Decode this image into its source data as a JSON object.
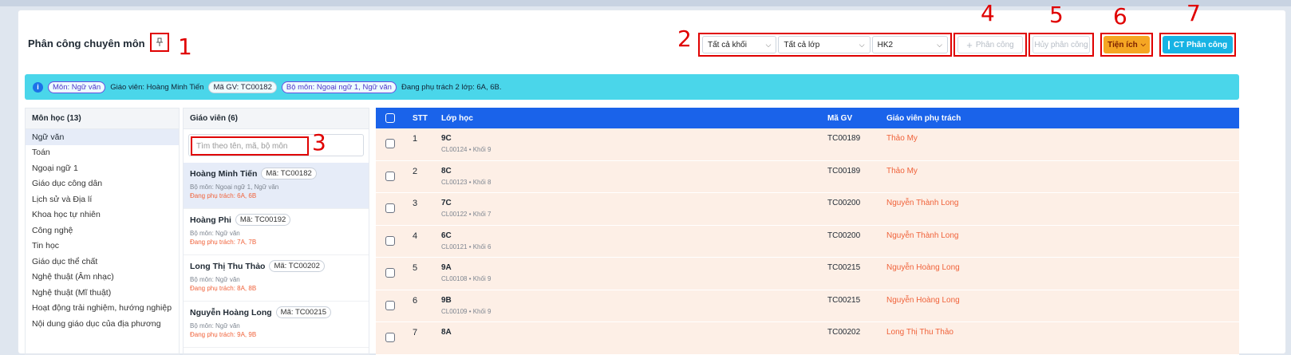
{
  "header": {
    "title": "Phân công chuyên môn",
    "pin_icon": "pin-icon",
    "filters": {
      "grade": "Tất cả khối",
      "class": "Tất cả lớp",
      "semester": "HK2"
    },
    "buttons": {
      "assign": "Phân công",
      "unassign": "Hủy phân công",
      "utilities": "Tiện ích",
      "detail": "CT Phân công"
    }
  },
  "annotations": [
    "1",
    "2",
    "3",
    "4",
    "5",
    "6",
    "7"
  ],
  "info": {
    "subject_tag": "Môn: Ngữ văn",
    "teacher": "Giáo viên: Hoàng Minh Tiến",
    "code": "Mã GV: TC00182",
    "dept_tag": "Bộ môn: Ngoại ngữ 1, Ngữ văn",
    "summary": "Đang phụ trách 2 lớp: 6A, 6B."
  },
  "subjects": {
    "header": "Môn học (13)",
    "items": [
      "Ngữ văn",
      "Toán",
      "Ngoại ngữ 1",
      "Giáo dục công dân",
      "Lịch sử và Địa lí",
      "Khoa học tự nhiên",
      "Công nghệ",
      "Tin học",
      "Giáo dục thể chất",
      "Nghệ thuật (Âm nhạc)",
      "Nghệ thuật (Mĩ thuật)",
      "Hoạt động trải nghiệm, hướng nghiệp",
      "Nội dung giáo dục của địa phương"
    ]
  },
  "teachers": {
    "header": "Giáo viên (6)",
    "search_placeholder": "Tìm theo tên, mã, bộ môn",
    "items": [
      {
        "name": "Hoàng Minh Tiến",
        "code": "Mã: TC00182",
        "dept": "Bộ môn: Ngoại ngữ 1, Ngữ văn",
        "resp": "Đang phụ trách: 6A, 6B"
      },
      {
        "name": "Hoàng Phi",
        "code": "Mã: TC00192",
        "dept": "Bộ môn: Ngữ văn",
        "resp": "Đang phụ trách: 7A, 7B"
      },
      {
        "name": "Long Thị Thu Thảo",
        "code": "Mã: TC00202",
        "dept": "Bộ môn: Ngữ văn",
        "resp": "Đang phụ trách: 8A, 8B"
      },
      {
        "name": "Nguyễn Hoàng Long",
        "code": "Mã: TC00215",
        "dept": "Bộ môn: Ngữ văn",
        "resp": "Đang phụ trách: 9A, 9B"
      }
    ]
  },
  "table": {
    "headers": {
      "stt": "STT",
      "class": "Lớp học",
      "code": "Mã GV",
      "resp": "Giáo viên phụ trách"
    },
    "rows": [
      {
        "stt": "1",
        "class": "9C",
        "sub": "CL00124 • Khối 9",
        "code": "TC00189",
        "resp": "Thảo My"
      },
      {
        "stt": "2",
        "class": "8C",
        "sub": "CL00123 • Khối 8",
        "code": "TC00189",
        "resp": "Thảo My"
      },
      {
        "stt": "3",
        "class": "7C",
        "sub": "CL00122 • Khối 7",
        "code": "TC00200",
        "resp": "Nguyễn Thành Long"
      },
      {
        "stt": "4",
        "class": "6C",
        "sub": "CL00121 • Khối 6",
        "code": "TC00200",
        "resp": "Nguyễn Thành Long"
      },
      {
        "stt": "5",
        "class": "9A",
        "sub": "CL00108 • Khối 9",
        "code": "TC00215",
        "resp": "Nguyễn Hoàng Long"
      },
      {
        "stt": "6",
        "class": "9B",
        "sub": "CL00109 • Khối 9",
        "code": "TC00215",
        "resp": "Nguyễn Hoàng Long"
      },
      {
        "stt": "7",
        "class": "8A",
        "sub": "",
        "code": "TC00202",
        "resp": "Long Thị Thu Thảo"
      }
    ]
  },
  "colors": {
    "accent": "#1a63ea",
    "info_bar": "#4ad6ea",
    "highlight": "#e00000",
    "orange": "#f5a623",
    "cyan": "#17b3e4"
  }
}
